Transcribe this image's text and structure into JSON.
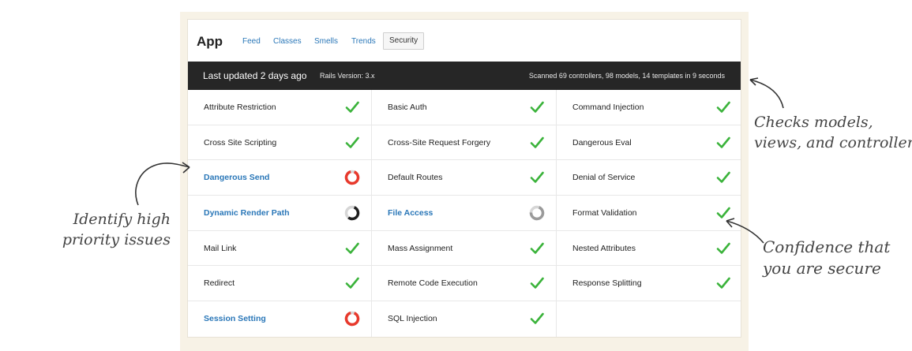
{
  "app": {
    "title": "App",
    "tabs": [
      {
        "label": "Feed",
        "active": false
      },
      {
        "label": "Classes",
        "active": false
      },
      {
        "label": "Smells",
        "active": false
      },
      {
        "label": "Trends",
        "active": false
      },
      {
        "label": "Security",
        "active": true
      }
    ]
  },
  "status_bar": {
    "updated": "Last updated 2 days ago",
    "rails_version": "Rails Version: 3.x",
    "scanned": "Scanned 69 controllers, 98 models, 14 templates in 9 seconds"
  },
  "checks": [
    [
      {
        "label": "Attribute Restriction",
        "status": "ok"
      },
      {
        "label": "Basic Auth",
        "status": "ok"
      },
      {
        "label": "Command Injection",
        "status": "ok"
      }
    ],
    [
      {
        "label": "Cross Site Scripting",
        "status": "ok"
      },
      {
        "label": "Cross-Site Request Forgery",
        "status": "ok"
      },
      {
        "label": "Dangerous Eval",
        "status": "ok"
      }
    ],
    [
      {
        "label": "Dangerous Send",
        "status": "high"
      },
      {
        "label": "Default Routes",
        "status": "ok"
      },
      {
        "label": "Denial of Service",
        "status": "ok"
      }
    ],
    [
      {
        "label": "Dynamic Render Path",
        "status": "medium"
      },
      {
        "label": "File Access",
        "status": "low"
      },
      {
        "label": "Format Validation",
        "status": "ok"
      }
    ],
    [
      {
        "label": "Mail Link",
        "status": "ok"
      },
      {
        "label": "Mass Assignment",
        "status": "ok"
      },
      {
        "label": "Nested Attributes",
        "status": "ok"
      }
    ],
    [
      {
        "label": "Redirect",
        "status": "ok"
      },
      {
        "label": "Remote Code Execution",
        "status": "ok"
      },
      {
        "label": "Response Splitting",
        "status": "ok"
      }
    ],
    [
      {
        "label": "Session Setting",
        "status": "high"
      },
      {
        "label": "SQL Injection",
        "status": "ok"
      },
      null
    ]
  ],
  "annotations": {
    "checks_models": [
      "Checks models,",
      "views, and controllers"
    ],
    "identify": [
      "Identify high",
      "priority issues"
    ],
    "confidence": [
      "Confidence that",
      "you are secure"
    ]
  },
  "colors": {
    "ok": "#3bb33b",
    "high": "#e8392c",
    "medium": "#1f1f1f",
    "low": "#9a9a9a",
    "link": "#2a77b8"
  }
}
